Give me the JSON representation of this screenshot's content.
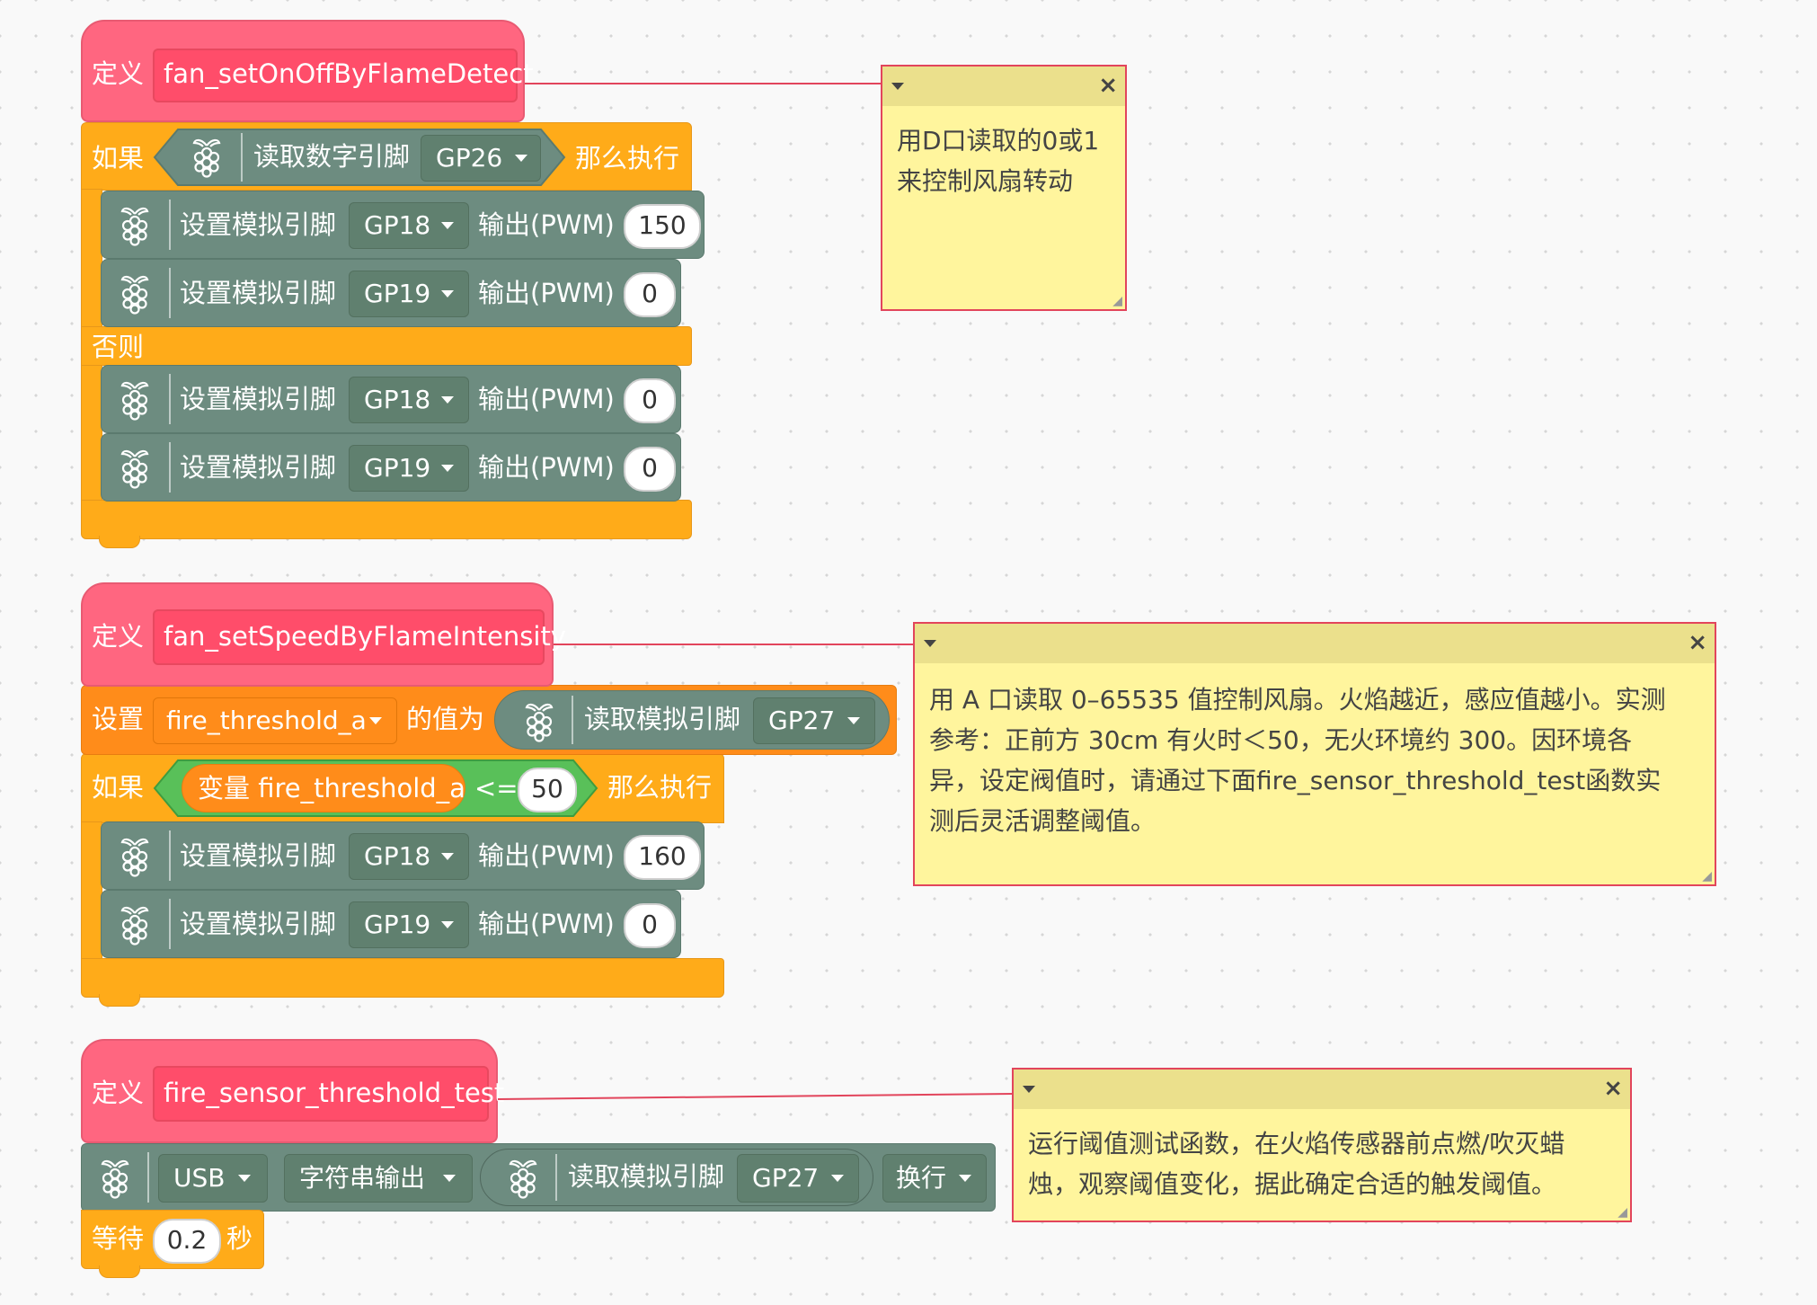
{
  "raspberry_icon": "raspberry-pi-icon",
  "colors": {
    "define": "#ff6680",
    "control": "#ffab19",
    "pin_block": "#6d8c80",
    "variable": "#ff8c1a",
    "operator": "#59c059",
    "note": "#fff59d"
  },
  "group1": {
    "define_label": "定义",
    "func_name": "fan_setOnOffByFlameDetect",
    "if_label": "如果",
    "read_digital": "读取数字引脚",
    "cond_pin": "GP26",
    "then_label": "那么执行",
    "else_label": "否则",
    "stmts": [
      {
        "label": "设置模拟引脚",
        "pin": "GP18",
        "out": "输出(PWM)",
        "value": "150"
      },
      {
        "label": "设置模拟引脚",
        "pin": "GP19",
        "out": "输出(PWM)",
        "value": "0"
      },
      {
        "label": "设置模拟引脚",
        "pin": "GP18",
        "out": "输出(PWM)",
        "value": "0"
      },
      {
        "label": "设置模拟引脚",
        "pin": "GP19",
        "out": "输出(PWM)",
        "value": "0"
      }
    ],
    "note": {
      "line1": "用D口读取的0或1",
      "line2": "来控制风扇转动"
    }
  },
  "group2": {
    "define_label": "定义",
    "func_name": "fan_setSpeedByFlameIntensity",
    "set_label": "设置",
    "var_name": "fire_threshold_a",
    "set_to": "的值为",
    "read_analog": "读取模拟引脚",
    "read_pin": "GP27",
    "if_label": "如果",
    "cond_var": "变量 fire_threshold_a",
    "cond_op": "<=",
    "cond_value": "50",
    "then_label": "那么执行",
    "stmts": [
      {
        "label": "设置模拟引脚",
        "pin": "GP18",
        "out": "输出(PWM)",
        "value": "160"
      },
      {
        "label": "设置模拟引脚",
        "pin": "GP19",
        "out": "输出(PWM)",
        "value": "0"
      }
    ],
    "note": {
      "line1": "用 A 口读取 0–65535 值控制风扇。火焰越近，感应值越小。实测",
      "line2": "参考：正前方 30cm 有火时＜50，无火环境约 300。因环境各",
      "line3": "异，设定阀值时，请通过下面fire_sensor_threshold_test函数实",
      "line4": "测后灵活调整阈值。"
    }
  },
  "group3": {
    "define_label": "定义",
    "func_name": "fire_sensor_threshold_test",
    "port": "USB",
    "print_label": "字符串输出",
    "read_analog": "读取模拟引脚",
    "read_pin": "GP27",
    "newline": "换行",
    "wait_label": "等待",
    "wait_value": "0.2",
    "sec_label": "秒",
    "note": {
      "line1": "运行阈值测试函数，在火焰传感器前点燃/吹灭蜡",
      "line2": "烛，观察阈值变化，据此确定合适的触发阈值。"
    }
  }
}
